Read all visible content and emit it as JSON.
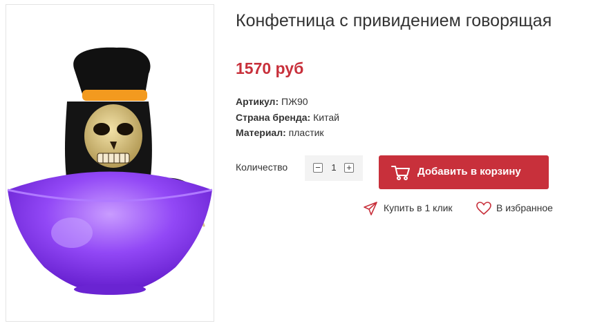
{
  "product": {
    "title": "Конфетница с привидением говорящая",
    "price": "1570 руб",
    "image_alt": "skeleton-candy-bowl-image"
  },
  "properties": [
    {
      "key": "Артикул:",
      "value": "ПЖ90"
    },
    {
      "key": "Страна бренда:",
      "value": "Китай"
    },
    {
      "key": "Материал:",
      "value": "пластик"
    }
  ],
  "quantity": {
    "label": "Количество",
    "value": "1",
    "minus": "−",
    "plus": "+"
  },
  "actions": {
    "add_to_cart": "Добавить в корзину",
    "buy_one_click": "Купить в 1 клик",
    "favorites": "В избранное"
  },
  "colors": {
    "accent": "#c8303b",
    "bowl": "#8a3cf0",
    "text": "#333333"
  },
  "icons": {
    "cart": "cart-icon",
    "send": "send-icon",
    "heart": "heart-icon"
  }
}
